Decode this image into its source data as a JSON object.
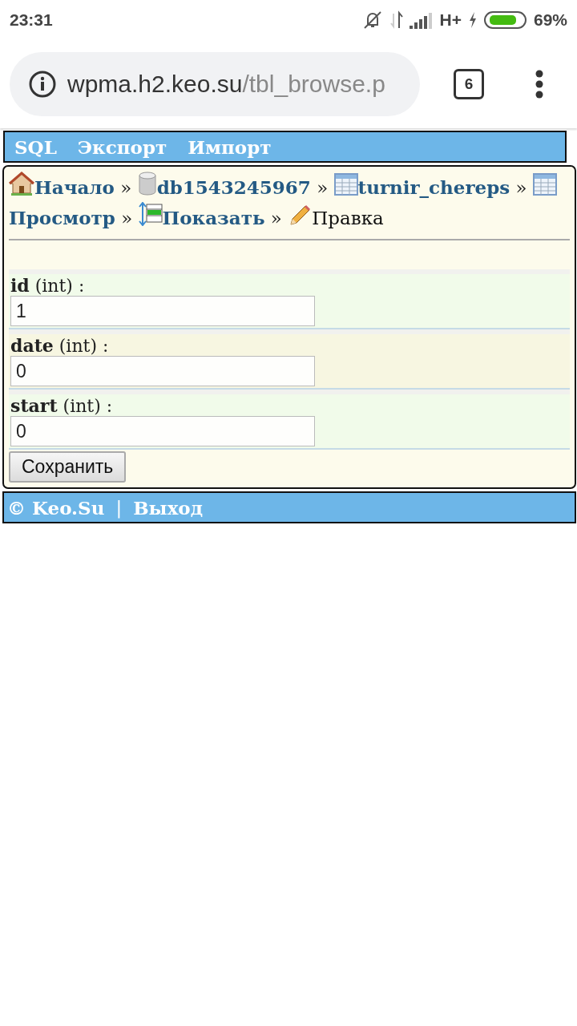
{
  "status_bar": {
    "time": "23:31",
    "network": "H+",
    "battery": "69%"
  },
  "browser": {
    "url_host": "wpma.h2.keo.su",
    "url_path": "/tbl_browse.p",
    "tab_count": "6"
  },
  "top_menu": [
    {
      "label": "SQL"
    },
    {
      "label": "Экспорт"
    },
    {
      "label": "Импорт"
    }
  ],
  "breadcrumb": [
    {
      "kind": "home",
      "label": "Начало",
      "link": true,
      "separator": "»"
    },
    {
      "kind": "database",
      "label": "db1543245967",
      "link": true,
      "separator": "»"
    },
    {
      "kind": "table",
      "label": "turnir_chereps",
      "link": true,
      "separator": "»"
    },
    {
      "kind": "table",
      "label": "Просмотр",
      "link": true,
      "separator": "»"
    },
    {
      "kind": "columns",
      "label": "Показать",
      "link": true,
      "separator": "»"
    },
    {
      "kind": "edit",
      "label": "Правка",
      "link": false
    }
  ],
  "fields": [
    {
      "label": "**id** (int) :",
      "value": "1"
    },
    {
      "label": "**date** (int) :",
      "value": "0"
    },
    {
      "label": "**start** (int) :",
      "value": "0"
    }
  ],
  "save_button": "Сохранить",
  "footer": {
    "copyright": "© Keo.Su",
    "separator": "|",
    "logout": "Выход"
  }
}
